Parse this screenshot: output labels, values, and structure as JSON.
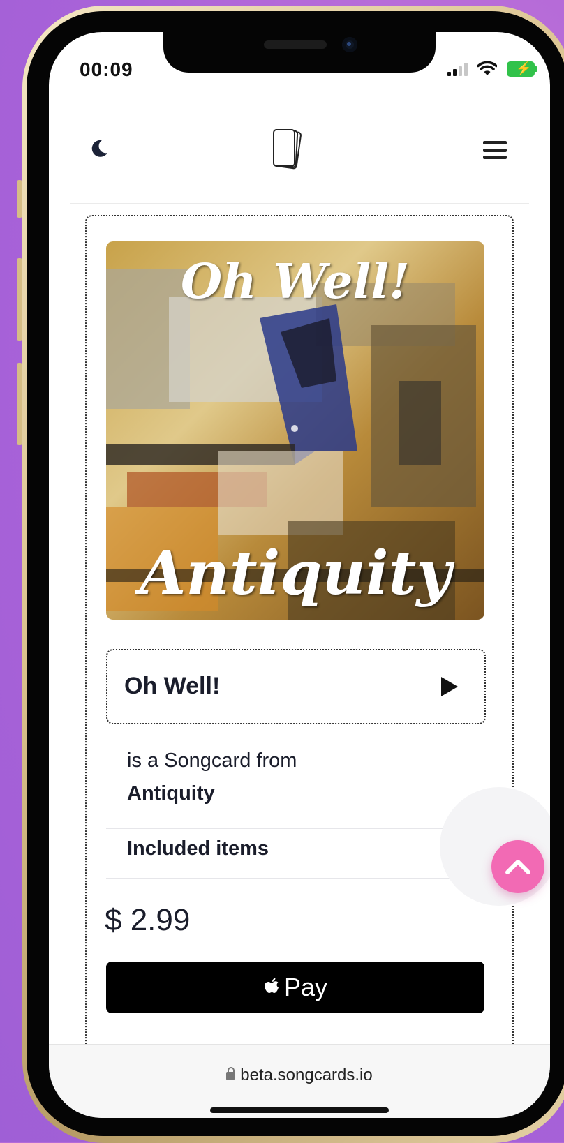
{
  "status_bar": {
    "time": "00:09"
  },
  "header": {
    "logo_name": "songcards-logo"
  },
  "songcard": {
    "artwork_title": "Oh Well!",
    "artwork_artist": "Antiquity",
    "song_title": "Oh Well!",
    "from_text": "is a Songcard from",
    "artist": "Antiquity",
    "included_label": "Included items",
    "price": "$ 2.99"
  },
  "payment": {
    "apple_pay_label": "Pay"
  },
  "browser": {
    "url": "beta.songcards.io"
  }
}
